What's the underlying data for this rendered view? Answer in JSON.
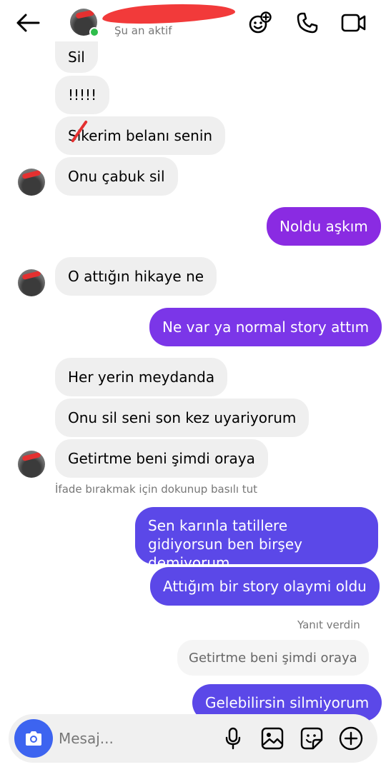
{
  "header": {
    "status": "Şu an aktif",
    "icons": [
      "back-arrow-icon",
      "effects-icon",
      "phone-icon",
      "video-icon"
    ]
  },
  "messages": {
    "m1": "Sil",
    "m2": "!!!!!",
    "m3": "Sikerim belanı senin",
    "m4": "Onu çabuk sil",
    "m5": "Noldu aşkım",
    "m6": "O attığın hikaye ne",
    "m7": "Ne var ya normal story attım",
    "m8": "Her yerin meydanda",
    "m9": "Onu sil seni son kez uyariyorum",
    "m10": "Getirtme beni şimdi oraya",
    "m11": "Sen karınla tatillere gidiyorsun ben birşey demiyorum",
    "m12": "Attığım bir story olaymi oldu",
    "m13": "Gelebilirsin silmiyorum"
  },
  "hint": "İfade bırakmak için dokunup basılı tut",
  "reply": {
    "label": "Yanıt verdin",
    "quote": "Getirtme beni şimdi oraya"
  },
  "composer": {
    "placeholder": "Mesaj...",
    "icons": [
      "camera-icon",
      "microphone-icon",
      "gallery-icon",
      "sticker-icon",
      "plus-icon"
    ]
  },
  "colors": {
    "incoming": "#efefef",
    "outgoing_purple": "#8a2be2",
    "outgoing_violet": "#7b36e8",
    "outgoing_indigo": "#5b48e8",
    "camera": "#3d64f0",
    "online": "#2fbd4b"
  }
}
